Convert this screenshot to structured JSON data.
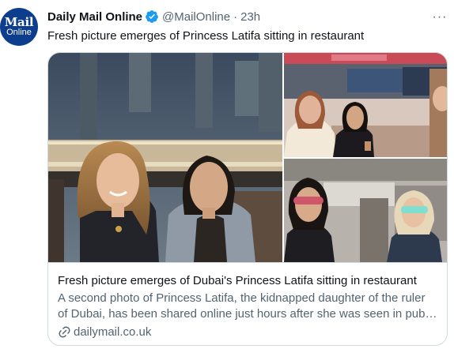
{
  "tweet": {
    "avatar": {
      "line1": "Mail",
      "line2": "Online"
    },
    "author_name": "Daily Mail Online",
    "handle": "@MailOnline",
    "separator": "·",
    "time": "23h",
    "more_label": "···",
    "text": "Fresh picture emerges of Princess Latifa sitting in restaurant"
  },
  "card": {
    "title": "Fresh picture emerges of Dubai's Princess Latifa sitting in restaurant",
    "description_line1": "A second photo of Princess Latifa, the kidnapped daughter of the ruler",
    "description_line2": "of Dubai, has been shared online just hours after she was seen in publi...",
    "domain": "dailymail.co.uk"
  },
  "icons": {
    "verified": "verified-badge-icon",
    "more": "more-options-icon",
    "link": "link-icon"
  },
  "colors": {
    "verified": "#1d9bf0",
    "avatar_bg": "#0d3e8e",
    "secondary_text": "#536471",
    "border": "#cfd9de"
  }
}
